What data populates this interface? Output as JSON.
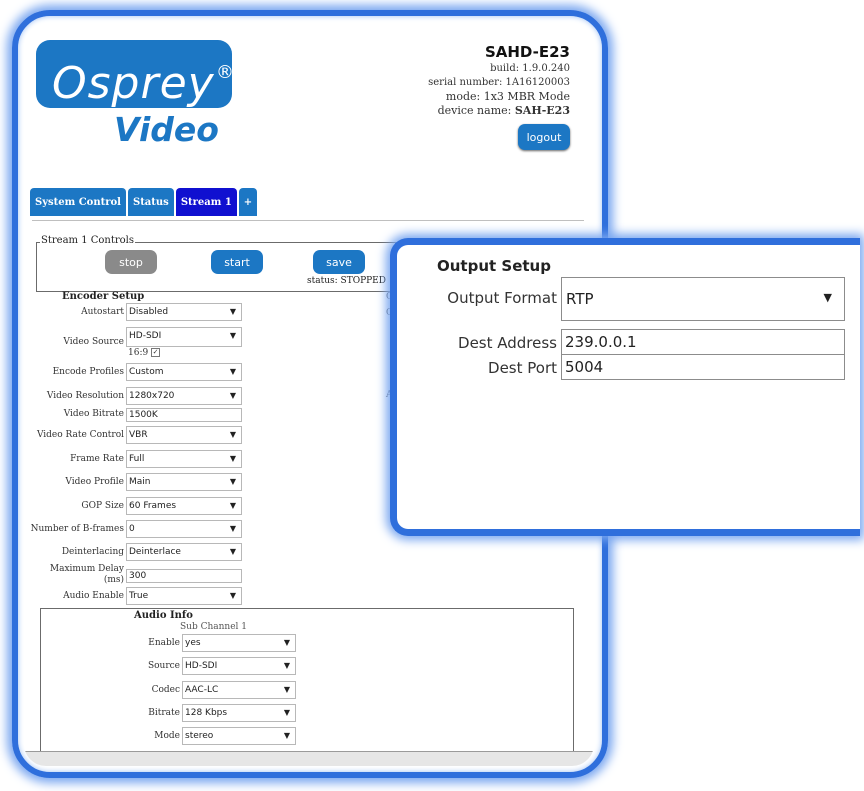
{
  "brand": {
    "logo_word": "Osprey",
    "logo_reg": "®",
    "logo_sub": "Video"
  },
  "device": {
    "model": "SAHD-E23",
    "build": "build: 1.9.0.240",
    "serial": "serial number: 1A16120003",
    "mode": "mode: 1x3 MBR Mode",
    "device_name_label": "device name: ",
    "device_name": "SAH-E23"
  },
  "logout_label": "logout",
  "tabs": [
    {
      "label": "System Control"
    },
    {
      "label": "Status"
    },
    {
      "label": "Stream 1"
    },
    {
      "label": "+"
    }
  ],
  "controls": {
    "legend": "Stream 1 Controls",
    "stop": "stop",
    "start": "start",
    "save": "save",
    "status": "status: STOPPED"
  },
  "encoder": {
    "title": "Encoder Setup",
    "fields": {
      "autostart": {
        "label": "Autostart",
        "value": "Disabled"
      },
      "video_source": {
        "label": "Video Source",
        "value": "HD-SDI"
      },
      "aspect": {
        "label": "16:9",
        "checked": "✓"
      },
      "encode_profiles": {
        "label": "Encode Profiles",
        "value": "Custom"
      },
      "video_resolution": {
        "label": "Video Resolution",
        "value": "1280x720"
      },
      "video_bitrate": {
        "label": "Video Bitrate",
        "value": "1500K"
      },
      "video_rate_control": {
        "label": "Video Rate Control",
        "value": "VBR"
      },
      "frame_rate": {
        "label": "Frame Rate",
        "value": "Full"
      },
      "video_profile": {
        "label": "Video Profile",
        "value": "Main"
      },
      "gop_size": {
        "label": "GOP Size",
        "value": "60 Frames"
      },
      "b_frames": {
        "label": "Number of B-frames",
        "value": "0"
      },
      "deinterlacing": {
        "label": "Deinterlacing",
        "value": "Deinterlace"
      },
      "max_delay": {
        "label": "Maximum Delay (ms)",
        "value": "300"
      },
      "audio_enable": {
        "label": "Audio Enable",
        "value": "True"
      }
    }
  },
  "audio": {
    "title": "Audio Info",
    "subchannel": "Sub Channel 1",
    "fields": {
      "enable": {
        "label": "Enable",
        "value": "yes"
      },
      "source": {
        "label": "Source",
        "value": "HD-SDI"
      },
      "codec": {
        "label": "Codec",
        "value": "AAC-LC"
      },
      "bitrate": {
        "label": "Bitrate",
        "value": "128 Kbps"
      },
      "mode": {
        "label": "Mode",
        "value": "stereo"
      }
    }
  },
  "output_stubs": {
    "a": "O",
    "b": "O",
    "c": "A"
  },
  "output": {
    "title": "Output Setup",
    "format_label": "Output Format",
    "format_value": "RTP",
    "dest_address_label": "Dest Address",
    "dest_address_value": "239.0.0.1",
    "dest_port_label": "Dest Port",
    "dest_port_value": "5004"
  },
  "colors": {
    "accent": "#1c77c4",
    "frame": "#2f6fdc",
    "tab_active": "#1010d0",
    "button_gray": "#8a8a8a"
  },
  "icons": {
    "dropdown": "triangle-down-icon",
    "checkbox": "checkbox-checked-icon"
  }
}
